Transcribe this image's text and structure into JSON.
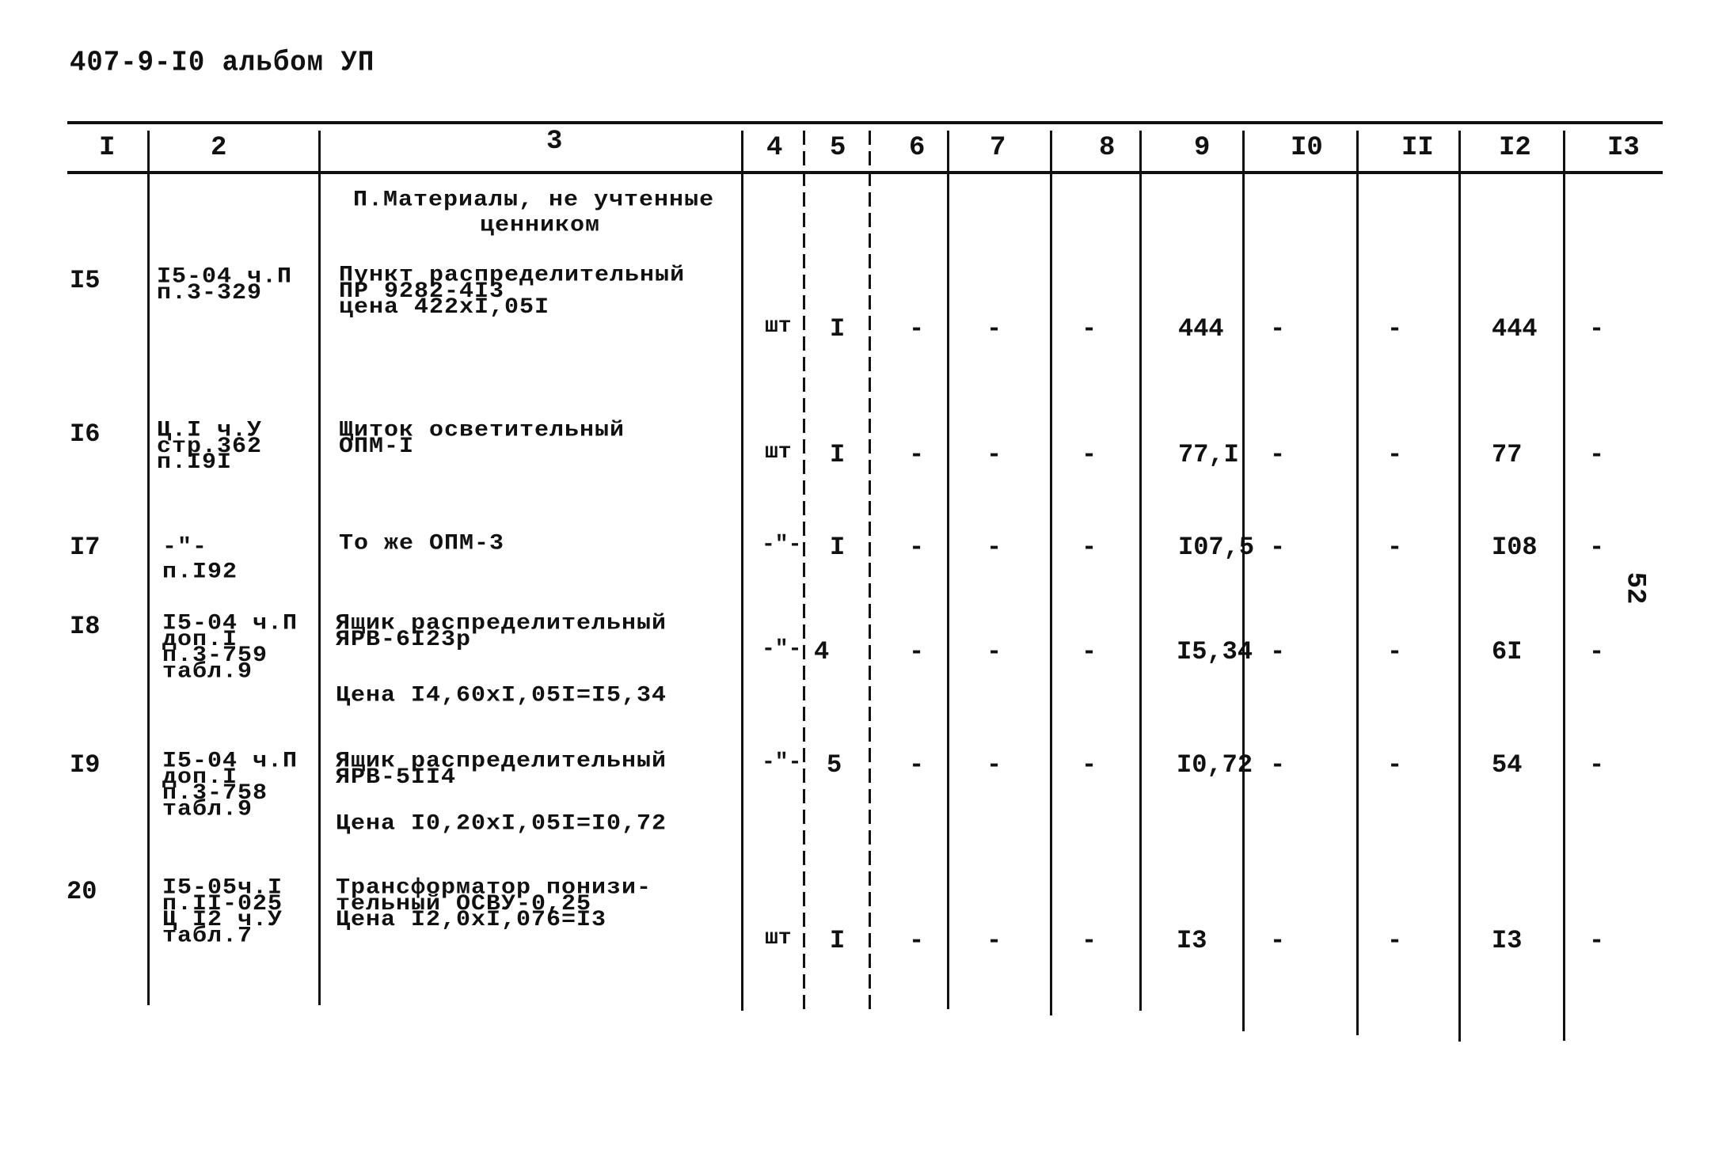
{
  "document": {
    "header_code": "407-9-I0 альбом УП",
    "page_number": "52"
  },
  "table": {
    "columns": [
      "I",
      "2",
      "3",
      "4",
      "5",
      "6",
      "7",
      "8",
      "9",
      "I0",
      "II",
      "I2",
      "I3"
    ],
    "section_title": [
      "П.Материалы, не учтенные",
      "ценником"
    ],
    "rows": [
      {
        "no": "I5",
        "ref": [
          "I5-04 ч.П",
          "п.3-329"
        ],
        "name": [
          "Пункт распределительный",
          "ПР 9282-4I3",
          " цена 422xI,05I"
        ],
        "unit": "шт",
        "qty": "I",
        "c6": "-",
        "c7": "-",
        "c8": "-",
        "c9": "444",
        "c10": "-",
        "c11": "-",
        "c12": "444",
        "c13": "-"
      },
      {
        "no": "I6",
        "ref": [
          "Ц.I ч.У",
          "стр.362",
          "п.I9I"
        ],
        "name": [
          "Щиток осветительный",
          " ОПМ-I"
        ],
        "unit": "шт",
        "qty": "I",
        "c6": "-",
        "c7": "-",
        "c8": "-",
        "c9": "77,I",
        "c10": "-",
        "c11": "-",
        "c12": "77",
        "c13": "-"
      },
      {
        "no": "I7",
        "ref": [
          " -\"-",
          " п.I92"
        ],
        "name": [
          "То же ОПМ-3"
        ],
        "unit": "-\"-",
        "qty": "I",
        "c6": "-",
        "c7": "-",
        "c8": "-",
        "c9": "I07,5",
        "c10": "-",
        "c11": "-",
        "c12": "I08",
        "c13": "-"
      },
      {
        "no": "I8",
        "ref": [
          "I5-04 ч.П",
          "доп.I",
          "п.3-759",
          "табл.9"
        ],
        "name": [
          "Ящик распределительный",
          "ЯРВ-6I23р"
        ],
        "price": "Цена I4,60xI,05I=I5,34",
        "unit": "-\"-",
        "qty": "4",
        "c6": "-",
        "c7": "-",
        "c8": "-",
        "c9": "I5,34",
        "c10": "-",
        "c11": "-",
        "c12": "6I",
        "c13": "-"
      },
      {
        "no": "I9",
        "ref": [
          "I5-04 ч.П",
          "доп.I",
          "п.3-758",
          "табл.9"
        ],
        "name": [
          "Ящик распределительный",
          " ЯРВ-5II4"
        ],
        "price": "Цена I0,20xI,05I=I0,72",
        "unit": "-\"-",
        "qty": "5",
        "c6": "-",
        "c7": "-",
        "c8": "-",
        "c9": "I0,72",
        "c10": "-",
        "c11": "-",
        "c12": "54",
        "c13": "-"
      },
      {
        "no": "20",
        "ref": [
          "I5-05ч.I",
          "п.II-025",
          "Ц I2 ч.У",
          "табл.7"
        ],
        "name": [
          "Трансформатор понизи-",
          "тельный ОСВУ-0,25",
          "Цена I2,0xI,076=I3"
        ],
        "unit": "шт",
        "qty": "I",
        "c6": "-",
        "c7": "-",
        "c8": "-",
        "c9": "I3",
        "c10": "-",
        "c11": "-",
        "c12": "I3",
        "c13": "-"
      }
    ]
  }
}
